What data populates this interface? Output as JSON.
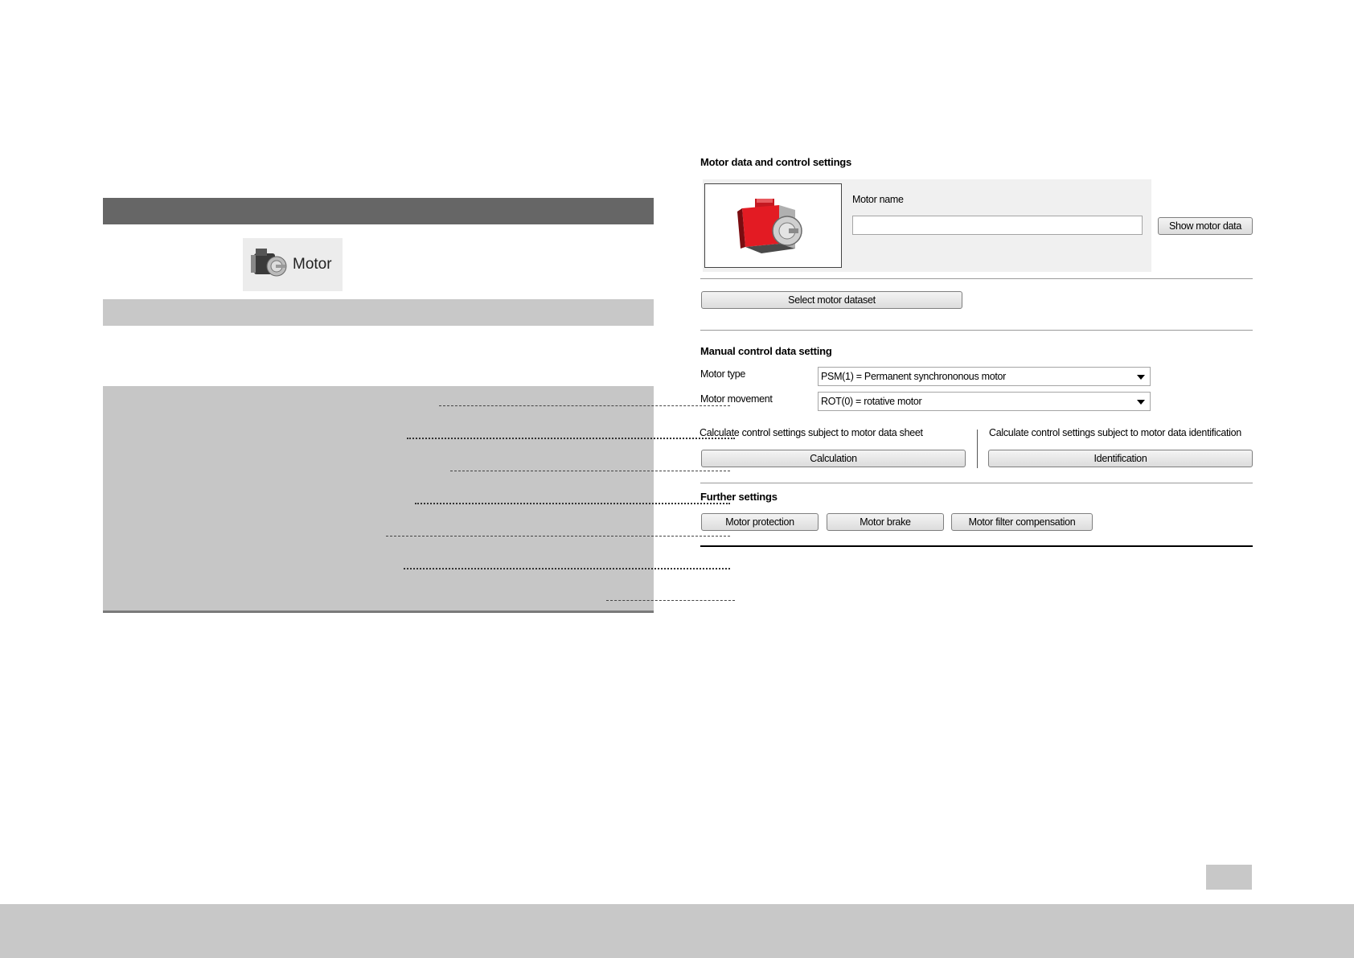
{
  "left_panel": {
    "motor_tile_label": "Motor"
  },
  "right_panel": {
    "section_motor_data": "Motor data and control settings",
    "motor_name_label": "Motor name",
    "motor_name_value": "",
    "show_motor_data_button": "Show motor data",
    "select_motor_dataset_button": "Select motor dataset",
    "section_manual": "Manual control data setting",
    "motor_type_label": "Motor type",
    "motor_type_value": "PSM(1) = Permanent synchrononous motor",
    "motor_movement_label": "Motor movement",
    "motor_movement_value": "ROT(0) = rotative motor",
    "calc_datasheet_label": "Calculate control settings subject to motor data sheet",
    "calc_identification_label": "Calculate control settings subject to motor data identification",
    "calculation_button": "Calculation",
    "identification_button": "Identification",
    "section_further": "Further settings",
    "motor_protection_button": "Motor protection",
    "motor_brake_button": "Motor brake",
    "motor_filter_button": "Motor filter compensation"
  },
  "colors": {
    "header_bar": "#666666",
    "light_bar": "#c8c8c8",
    "motor_red": "#e31b23"
  },
  "icons": [
    "motor-icon",
    "motor-image",
    "dropdown-arrow-icon"
  ]
}
